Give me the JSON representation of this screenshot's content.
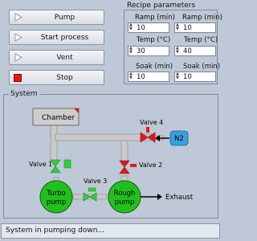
{
  "controls": {
    "pump_label": "Pump",
    "start_label": "Start process",
    "vent_label": "Vent",
    "stop_label": "Stop"
  },
  "recipe": {
    "title": "Recipe parameters",
    "fields": [
      {
        "label": "Ramp (min)",
        "value": "10"
      },
      {
        "label": "Ramp (min)",
        "value": "10"
      },
      {
        "label": "Temp (°C)",
        "value": "30"
      },
      {
        "label": "Temp (°C)",
        "value": "40"
      },
      {
        "label": "Soak (min)",
        "value": "10"
      },
      {
        "label": "Soak (min)",
        "value": "10"
      }
    ]
  },
  "system": {
    "title": "System",
    "chamber_label": "Chamber",
    "valve1_label": "Valve 1",
    "valve2_label": "Valve 2",
    "valve3_label": "Valve 3",
    "valve4_label": "Valve 4",
    "n2_label": "N2",
    "turbo_label_1": "Turbo",
    "turbo_label_2": "pump",
    "rough_label_1": "Rough",
    "rough_label_2": "pump",
    "exhaust_label": "Exhaust"
  },
  "status": {
    "text": "System in pumping down..."
  },
  "colors": {
    "background": "#bec8d6",
    "pump_green": "#22c01f",
    "valve_red": "#e0191f",
    "valve_green": "#2ed13a",
    "n2_blue": "#3aa0e0",
    "pipe_gray": "#c8c8c8"
  }
}
